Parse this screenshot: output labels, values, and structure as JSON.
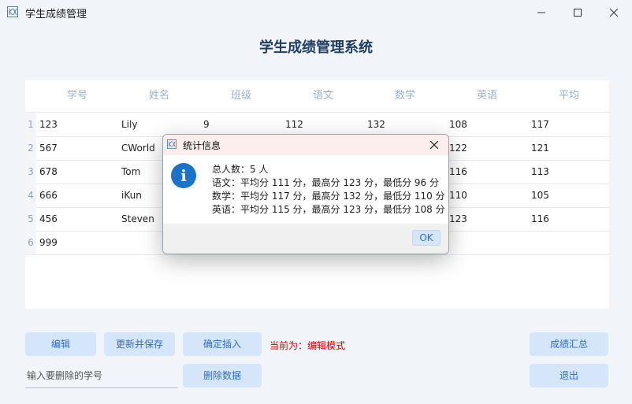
{
  "window": {
    "title": "学生成绩管理"
  },
  "main_title": "学生成绩管理系统",
  "table": {
    "headers": [
      "学号",
      "姓名",
      "班级",
      "语文",
      "数学",
      "英语",
      "平均"
    ],
    "rows": [
      {
        "num": "1",
        "cells": [
          "123",
          "Lily",
          "9",
          "112",
          "132",
          "108",
          "117"
        ]
      },
      {
        "num": "2",
        "cells": [
          "567",
          "CWorld",
          "",
          "",
          "",
          "122",
          "121"
        ]
      },
      {
        "num": "3",
        "cells": [
          "678",
          "Tom",
          "",
          "",
          "",
          "116",
          "113"
        ]
      },
      {
        "num": "4",
        "cells": [
          "666",
          "iKun",
          "",
          "",
          "",
          "110",
          "105"
        ]
      },
      {
        "num": "5",
        "cells": [
          "456",
          "Steven",
          "",
          "",
          "",
          "123",
          "116"
        ]
      },
      {
        "num": "6",
        "cells": [
          "999",
          "",
          "",
          "",
          "",
          "",
          ""
        ]
      }
    ]
  },
  "buttons": {
    "edit": "编辑",
    "update_save": "更新并保存",
    "confirm_insert": "确定插入",
    "summary": "成绩汇总",
    "delete": "删除数据",
    "exit": "退出"
  },
  "mode_label": "当前为：编辑模式",
  "delete_input": {
    "placeholder": "输入要删除的学号",
    "value": ""
  },
  "dialog": {
    "title": "统计信息",
    "lines": [
      "总人数：5 人",
      "语文：平均分 111 分，最高分 123 分，最低分 96 分",
      "数学：平均分 117 分，最高分 132 分，最低分 110 分",
      "英语：平均分 115 分，最高分 123 分，最低分 108 分"
    ],
    "ok_label": "OK",
    "info_glyph": "i"
  },
  "colors": {
    "accent": "#2f6fc7",
    "button_bg": "#d5e6fa",
    "title": "#1f3e66",
    "mode_red": "#e00000",
    "info_blue": "#1a73c8"
  },
  "icons": [
    "app-icon",
    "minimize-icon",
    "maximize-icon",
    "close-icon",
    "info-icon"
  ]
}
